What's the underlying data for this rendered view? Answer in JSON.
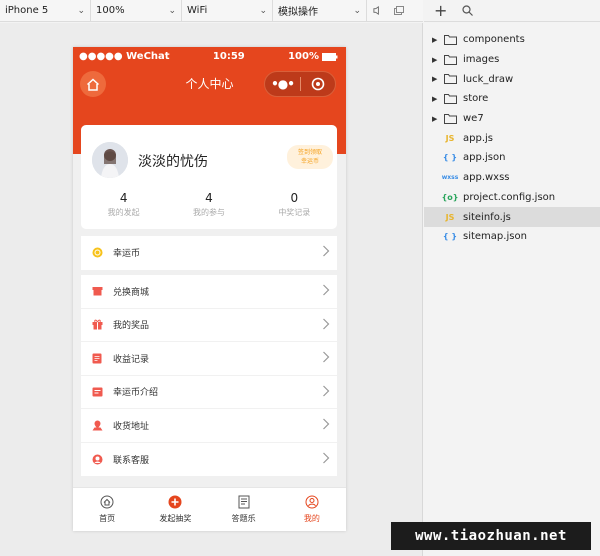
{
  "toolbar": {
    "device": "iPhone 5",
    "zoom": "100%",
    "network": "WiFi",
    "mode": "模拟操作"
  },
  "phone": {
    "status": {
      "carrier": "●●●●● WeChat",
      "time": "10:59",
      "battery": "100%"
    },
    "nav_title": "个人中心",
    "profile": {
      "username": "淡淡的忧伤",
      "badge_line1": "签到领取",
      "badge_line2": "幸运币",
      "stats": [
        {
          "value": "4",
          "label": "我的发起"
        },
        {
          "value": "4",
          "label": "我的参与"
        },
        {
          "value": "0",
          "label": "中奖记录"
        }
      ]
    },
    "menu_top": [
      {
        "label": "幸运币",
        "icon": "coin-icon",
        "color": "#f7c21a"
      }
    ],
    "menu_list": [
      {
        "label": "兑换商城",
        "icon": "shop-icon",
        "color": "#f05a4f"
      },
      {
        "label": "我的奖品",
        "icon": "gift-icon",
        "color": "#f05a4f"
      },
      {
        "label": "收益记录",
        "icon": "ledger-icon",
        "color": "#f05a4f"
      },
      {
        "label": "幸运币介绍",
        "icon": "intro-icon",
        "color": "#f05a4f"
      },
      {
        "label": "收货地址",
        "icon": "location-icon",
        "color": "#f05a4f"
      },
      {
        "label": "联系客服",
        "icon": "service-icon",
        "color": "#f05a4f"
      }
    ],
    "tabs": [
      {
        "label": "首页",
        "icon": "home-tab-icon",
        "active": false
      },
      {
        "label": "发起抽奖",
        "icon": "plus-circle-icon",
        "active": false
      },
      {
        "label": "答题乐",
        "icon": "quiz-icon",
        "active": false
      },
      {
        "label": "我的",
        "icon": "user-tab-icon",
        "active": true
      }
    ],
    "accent": "#e5461e"
  },
  "file_tree": [
    {
      "name": "components",
      "type": "folder"
    },
    {
      "name": "images",
      "type": "folder"
    },
    {
      "name": "luck_draw",
      "type": "folder"
    },
    {
      "name": "store",
      "type": "folder"
    },
    {
      "name": "we7",
      "type": "folder"
    },
    {
      "name": "app.js",
      "type": "js"
    },
    {
      "name": "app.json",
      "type": "json"
    },
    {
      "name": "app.wxss",
      "type": "wxss"
    },
    {
      "name": "project.config.json",
      "type": "config"
    },
    {
      "name": "siteinfo.js",
      "type": "js",
      "selected": true
    },
    {
      "name": "sitemap.json",
      "type": "json"
    }
  ],
  "watermark": "www.tiaozhuan.net"
}
